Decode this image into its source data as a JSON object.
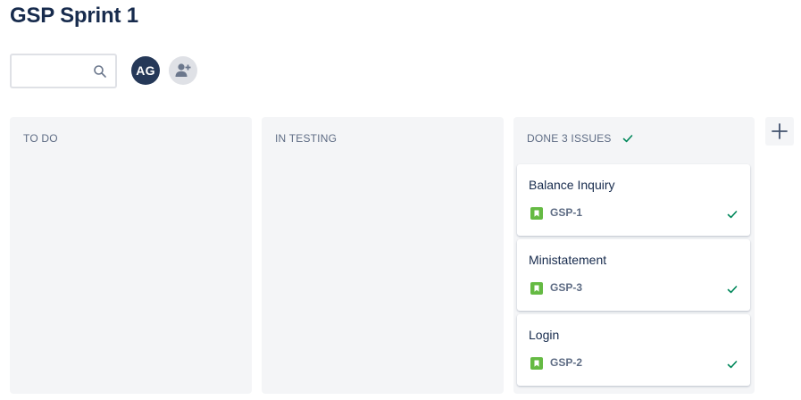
{
  "board": {
    "title": "GSP Sprint 1"
  },
  "search": {
    "value": "",
    "placeholder": ""
  },
  "people": {
    "avatar_initials": "AG",
    "avatar_color": "#253858"
  },
  "columns": [
    {
      "header": "TO DO",
      "cards": []
    },
    {
      "header": "IN TESTING",
      "cards": []
    },
    {
      "header": "DONE 3 ISSUES",
      "done_check": true,
      "cards": [
        {
          "title": "Balance Inquiry",
          "key": "GSP-1",
          "type_icon": "story-icon",
          "status_icon": "check-icon"
        },
        {
          "title": "Ministatement",
          "key": "GSP-3",
          "type_icon": "story-icon",
          "status_icon": "check-icon"
        },
        {
          "title": "Login",
          "key": "GSP-2",
          "type_icon": "story-icon",
          "status_icon": "check-icon"
        }
      ]
    }
  ],
  "colors": {
    "done_green": "#00875a",
    "story_green": "#65ba43",
    "column_bg": "#f4f5f7",
    "text_primary": "#172b4d",
    "text_secondary": "#5e6c84"
  }
}
